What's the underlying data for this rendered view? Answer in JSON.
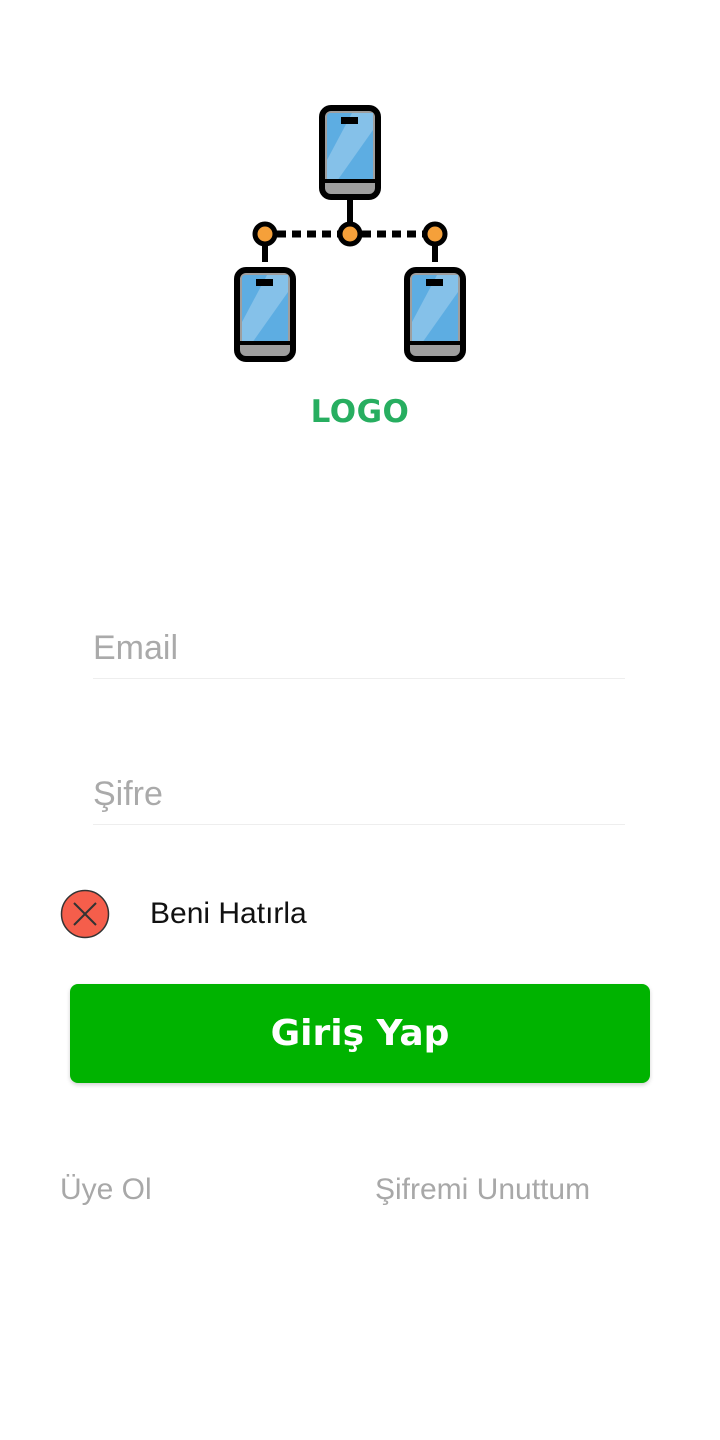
{
  "logo": {
    "text": "LOGO",
    "icon": "connected-phones-icon",
    "text_color": "#27ae60",
    "phone_screen_color": "#5dade2",
    "connector_dot_color": "#f5a03a"
  },
  "form": {
    "email": {
      "placeholder": "Email",
      "value": ""
    },
    "password": {
      "placeholder": "Şifre",
      "value": ""
    },
    "remember_me": {
      "label": "Beni Hatırla",
      "checked": false,
      "icon": "close-circle-icon",
      "icon_color": "#f55e4b"
    },
    "submit": {
      "label": "Giriş Yap",
      "color": "#00b300"
    }
  },
  "links": {
    "signup": "Üye Ol",
    "forgot_password": "Şifremi Unuttum"
  }
}
